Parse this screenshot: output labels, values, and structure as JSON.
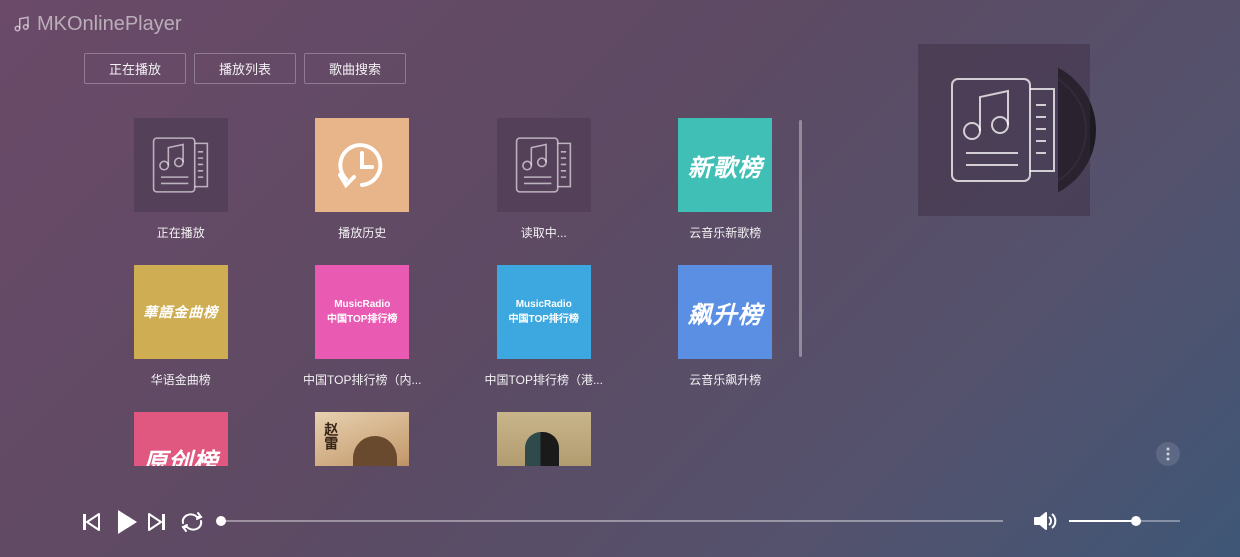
{
  "app": {
    "title": "MKOnlinePlayer"
  },
  "tabs": [
    {
      "label": "正在播放"
    },
    {
      "label": "播放列表"
    },
    {
      "label": "歌曲搜索"
    }
  ],
  "cards": [
    {
      "label": "正在播放",
      "cover": "music-list",
      "bg": "#55405a"
    },
    {
      "label": "播放历史",
      "cover": "history",
      "bg": "#e8b489"
    },
    {
      "label": "读取中...",
      "cover": "music-list",
      "bg": "#55405a"
    },
    {
      "label": "云音乐新歌榜",
      "cover": "text",
      "text": "新歌榜",
      "bg": "#3fbfb6"
    },
    {
      "label": "华语金曲榜",
      "cover": "text",
      "text": "華語金曲榜",
      "bg": "#cfae53"
    },
    {
      "label": "中国TOP排行榜（内...",
      "cover": "musicradio",
      "text1": "MusicRadio",
      "text2": "中国TOP排行榜",
      "bg": "#e95ab3"
    },
    {
      "label": "中国TOP排行榜（港...",
      "cover": "musicradio",
      "text1": "MusicRadio",
      "text2": "中国TOP排行榜",
      "bg": "#3da8df"
    },
    {
      "label": "云音乐飙升榜",
      "cover": "text",
      "text": "飙升榜",
      "bg": "#5a8fe3"
    },
    {
      "label": "",
      "cover": "text",
      "text": "原创榜",
      "bg": "#e0577f"
    },
    {
      "label": "",
      "cover": "photo",
      "text": "赵雷",
      "bg": "#c9a883"
    },
    {
      "label": "",
      "cover": "photo2",
      "bg": "#a89064"
    }
  ],
  "player": {
    "progress": 0.0,
    "volume": 0.6
  },
  "icons": {
    "prev": "skip-previous-icon",
    "play": "play-icon",
    "next": "skip-next-icon",
    "loop": "loop-icon",
    "volume": "volume-icon",
    "more": "more-vertical-icon"
  }
}
